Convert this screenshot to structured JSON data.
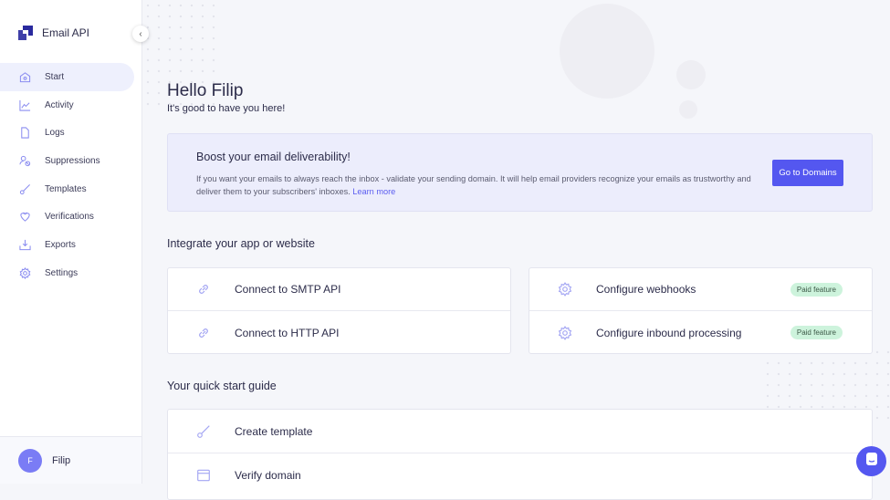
{
  "app": {
    "name": "Email API"
  },
  "sidebar": {
    "items": [
      {
        "label": "Start",
        "icon": "home-icon",
        "active": true
      },
      {
        "label": "Activity",
        "icon": "chart-line-icon"
      },
      {
        "label": "Logs",
        "icon": "file-icon"
      },
      {
        "label": "Suppressions",
        "icon": "user-block-icon"
      },
      {
        "label": "Templates",
        "icon": "brush-icon"
      },
      {
        "label": "Verifications",
        "icon": "heart-shield-icon"
      },
      {
        "label": "Exports",
        "icon": "download-icon"
      },
      {
        "label": "Settings",
        "icon": "gear-icon"
      }
    ],
    "user": {
      "initial": "F",
      "name": "Filip"
    }
  },
  "main": {
    "greeting": "Hello Filip",
    "subtitle": "It's good to have you here!",
    "banner": {
      "title": "Boost your email deliverability!",
      "text": "If you want your emails to always reach the inbox - validate your sending domain. It will help email providers recognize your emails as trustworthy and deliver them to your subscribers' inboxes. ",
      "link": "Learn more",
      "button": "Go to Domains"
    },
    "integrate": {
      "title": "Integrate your app or website",
      "left": [
        {
          "label": "Connect to SMTP API",
          "icon": "link-icon"
        },
        {
          "label": "Connect to HTTP API",
          "icon": "link-icon"
        }
      ],
      "right": [
        {
          "label": "Configure webhooks",
          "icon": "gear-icon",
          "badge": "Paid feature"
        },
        {
          "label": "Configure inbound processing",
          "icon": "gear-icon",
          "badge": "Paid feature"
        }
      ]
    },
    "guide": {
      "title": "Your quick start guide",
      "items": [
        {
          "label": "Create template",
          "icon": "brush-icon"
        },
        {
          "label": "Verify domain",
          "icon": "browser-window-icon"
        }
      ]
    }
  }
}
